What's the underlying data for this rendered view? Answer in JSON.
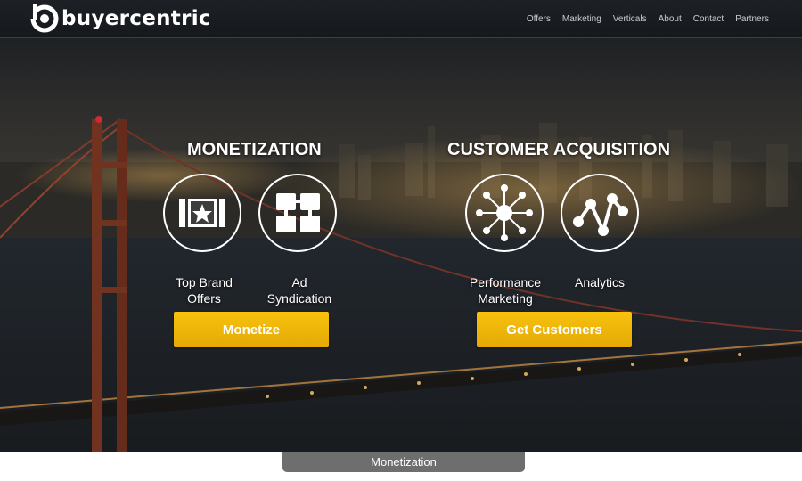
{
  "brand": {
    "name": "buyercentric"
  },
  "nav": {
    "items": [
      "Offers",
      "Marketing",
      "Verticals",
      "About",
      "Contact",
      "Partners"
    ]
  },
  "hero": {
    "monetization": {
      "title": "MONETIZATION",
      "features": [
        {
          "label_line1": "Top Brand",
          "label_line2": "Offers",
          "icon": "ticket-star-icon"
        },
        {
          "label_line1": "Ad",
          "label_line2": "Syndication",
          "icon": "block-diagram-icon"
        }
      ],
      "button_label": "Monetize"
    },
    "acquisition": {
      "title": "CUSTOMER ACQUISITION",
      "features": [
        {
          "label_line1": "Performance",
          "label_line2": "Marketing",
          "icon": "network-burst-icon"
        },
        {
          "label_line1": "Analytics",
          "label_line2": "",
          "icon": "line-graph-icon"
        }
      ],
      "button_label": "Get Customers"
    }
  },
  "bottom_tab": {
    "label": "Monetization"
  },
  "colors": {
    "accent": "#f5bb0a",
    "header_bg": "#1b1e22",
    "tab_bg": "#6e6e6e"
  }
}
